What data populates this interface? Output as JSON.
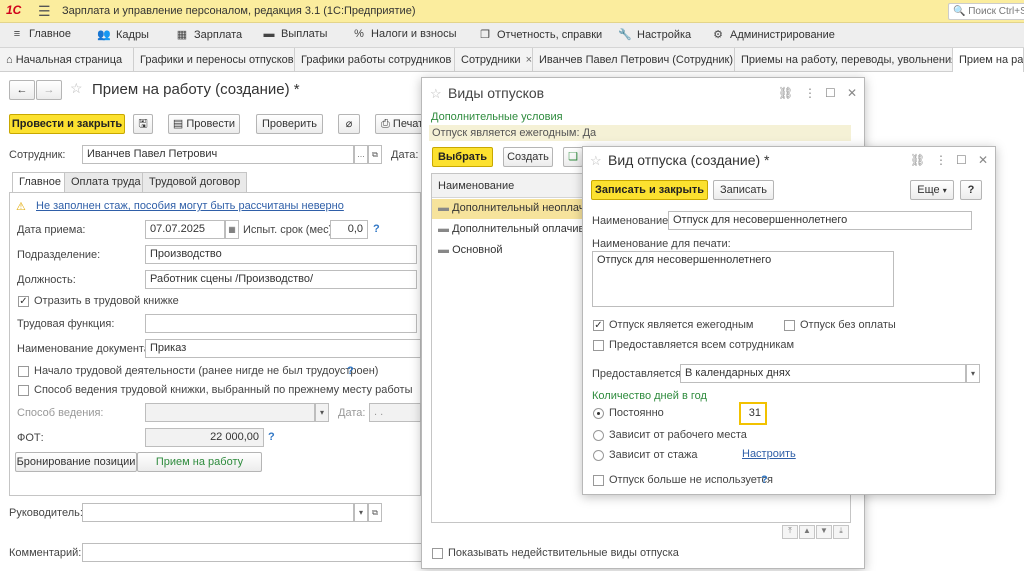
{
  "app": {
    "logo": "1С",
    "title": "Зарплата и управление персоналом, редакция 3.1  (1С:Предприятие)",
    "search_placeholder": "Поиск Ctrl+Shift+F"
  },
  "menu": [
    {
      "icon": "≡",
      "label": "Главное"
    },
    {
      "icon": "👥",
      "label": "Кадры"
    },
    {
      "icon": "▦",
      "label": "Зарплата"
    },
    {
      "icon": "▬",
      "label": "Выплаты"
    },
    {
      "icon": "%",
      "label": "Налоги и взносы"
    },
    {
      "icon": "❐",
      "label": "Отчетность, справки"
    },
    {
      "icon": "🔧",
      "label": "Настройка"
    },
    {
      "icon": "⚙",
      "label": "Администрирование"
    }
  ],
  "open_tabs": [
    "Начальная страница",
    "Графики и переносы отпусков",
    "Графики работы сотрудников",
    "Сотрудники",
    "Иванчев Павел Петрович (Сотрудник)",
    "Приемы на работу, переводы, увольнения",
    "Прием на работу (создание) *"
  ],
  "doc": {
    "title": "Прием на работу (создание) *",
    "btn_post_close": "Провести и закрыть",
    "btn_post": "Провести",
    "btn_check": "Проверить",
    "btn_print": "Печать",
    "employee_label": "Сотрудник:",
    "employee_value": "Иванчев Павел Петрович",
    "date_label": "Дата:",
    "tabs": [
      "Главное",
      "Оплата труда",
      "Трудовой договор"
    ],
    "warning": "Не заполнен стаж, пособия могут быть рассчитаны неверно",
    "hire_date_label": "Дата приема:",
    "hire_date": "07.07.2025",
    "probation_label": "Испыт. срок (мес):",
    "probation_value": "0,0",
    "dept_label": "Подразделение:",
    "dept_value": "Производство",
    "position_label": "Должность:",
    "position_value": "Работник сцены /Производство/",
    "reflect_label": "Отразить в трудовой книжке",
    "function_label": "Трудовая функция:",
    "docname_label": "Наименование документа:",
    "docname_value": "Приказ",
    "start_activity_label": "Начало трудовой деятельности (ранее нигде не был трудоустроен)",
    "method_prev_label": "Способ ведения трудовой книжки, выбранный по прежнему месту работы",
    "method_label": "Способ ведения:",
    "method_date_label": "Дата:",
    "method_date_value": ". .",
    "fot_label": "ФОТ:",
    "fot_value": "22 000,00",
    "reserve_btn": "Бронирование позиции",
    "hire_btn": "Прием на работу",
    "manager_label": "Руководитель:",
    "comment_label": "Комментарий:"
  },
  "leave_types": {
    "title": "Виды отпусков",
    "extra_conditions": "Дополнительные условия",
    "annual_filter": "Отпуск является ежегодным: Да",
    "btn_select": "Выбрать",
    "btn_create": "Создать",
    "col_name": "Наименование",
    "rows": [
      "Дополнительный неоплачиваемый",
      "Дополнительный оплачиваемый",
      "Основной"
    ],
    "show_inactive": "Показывать недействительные виды отпуска"
  },
  "leave_form": {
    "title": "Вид отпуска (создание) *",
    "btn_save_close": "Записать и закрыть",
    "btn_save": "Записать",
    "btn_more": "Еще",
    "btn_help": "?",
    "name_label": "Наименование:",
    "name_value": "Отпуск для несовершеннолетнего",
    "print_name_label": "Наименование для печати:",
    "print_name_value": "Отпуск для несовершеннолетнего",
    "annual_label": "Отпуск является ежегодным",
    "unpaid_label": "Отпуск без оплаты",
    "all_employees_label": "Предоставляется всем сотрудникам",
    "provided_label": "Предоставляется:",
    "provided_value": "В календарных днях",
    "days_header": "Количество дней в год",
    "opt_constant": "Постоянно",
    "days_value": "31",
    "opt_workplace": "Зависит от рабочего места",
    "opt_seniority": "Зависит от стажа",
    "configure_link": "Настроить",
    "not_used_label": "Отпуск больше не используется"
  }
}
